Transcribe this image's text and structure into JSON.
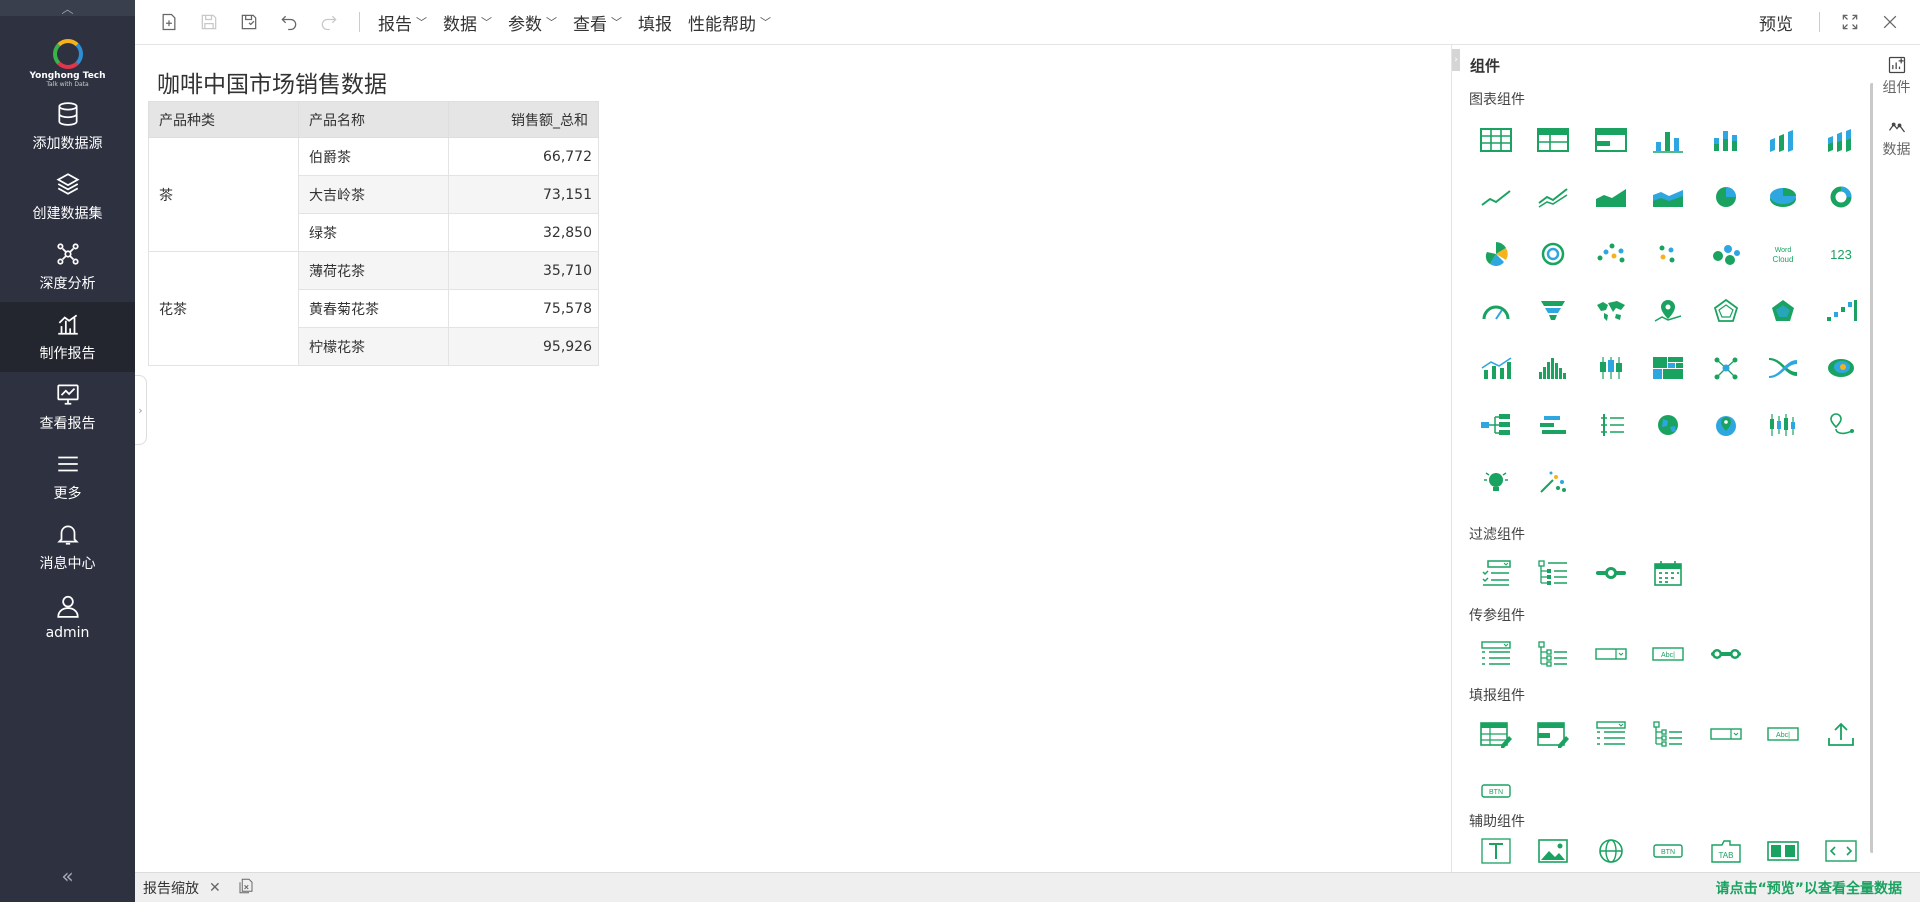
{
  "sidebar": {
    "logo": {
      "brand": "Yonghong Tech",
      "tagline": "Talk with Data"
    },
    "items": [
      {
        "label": "添加数据源",
        "icon": "database-icon"
      },
      {
        "label": "创建数据集",
        "icon": "layers-icon"
      },
      {
        "label": "深度分析",
        "icon": "molecule-icon"
      },
      {
        "label": "制作报告",
        "icon": "bar-chart-icon",
        "active": true
      },
      {
        "label": "查看报告",
        "icon": "monitor-chart-icon"
      },
      {
        "label": "更多",
        "icon": "menu-icon"
      },
      {
        "label": "消息中心",
        "icon": "bell-icon"
      },
      {
        "label": "admin",
        "icon": "user-icon"
      }
    ]
  },
  "toolbar": {
    "menus": [
      "报告",
      "数据",
      "参数",
      "查看",
      "填报",
      "性能帮助"
    ],
    "preview_label": "预览"
  },
  "report": {
    "title": "咖啡中国市场销售数据",
    "headers": [
      "产品种类",
      "产品名称",
      "销售额_总和"
    ],
    "groups": [
      {
        "category": "茶",
        "rows": [
          {
            "name": "伯爵茶",
            "value": "66,772"
          },
          {
            "name": "大吉岭茶",
            "value": "73,151"
          },
          {
            "name": "绿茶",
            "value": "32,850"
          }
        ]
      },
      {
        "category": "花茶",
        "rows": [
          {
            "name": "薄荷花茶",
            "value": "35,710"
          },
          {
            "name": "黄春菊花茶",
            "value": "75,578"
          },
          {
            "name": "柠檬花茶",
            "value": "95,926"
          }
        ]
      }
    ]
  },
  "panel": {
    "title": "组件",
    "sections": {
      "chart": "图表组件",
      "filter": "过滤组件",
      "param": "传参组件",
      "fill": "填报组件",
      "aux": "辅助组件"
    },
    "word_cloud_label": "Word Cloud",
    "number_label": "123",
    "btn_label": "BTN",
    "abc_label": "Abc|",
    "tab_label": "TAB",
    "accent_color": "#1aa260",
    "accent_blue": "#2ea7e0"
  },
  "right_tabs": [
    {
      "label": "组件",
      "icon": "component-icon"
    },
    {
      "label": "数据",
      "icon": "data-icon"
    }
  ],
  "bottombar": {
    "tab_label": "报告缩放",
    "hint": "请点击“预览”以查看全量数据"
  }
}
